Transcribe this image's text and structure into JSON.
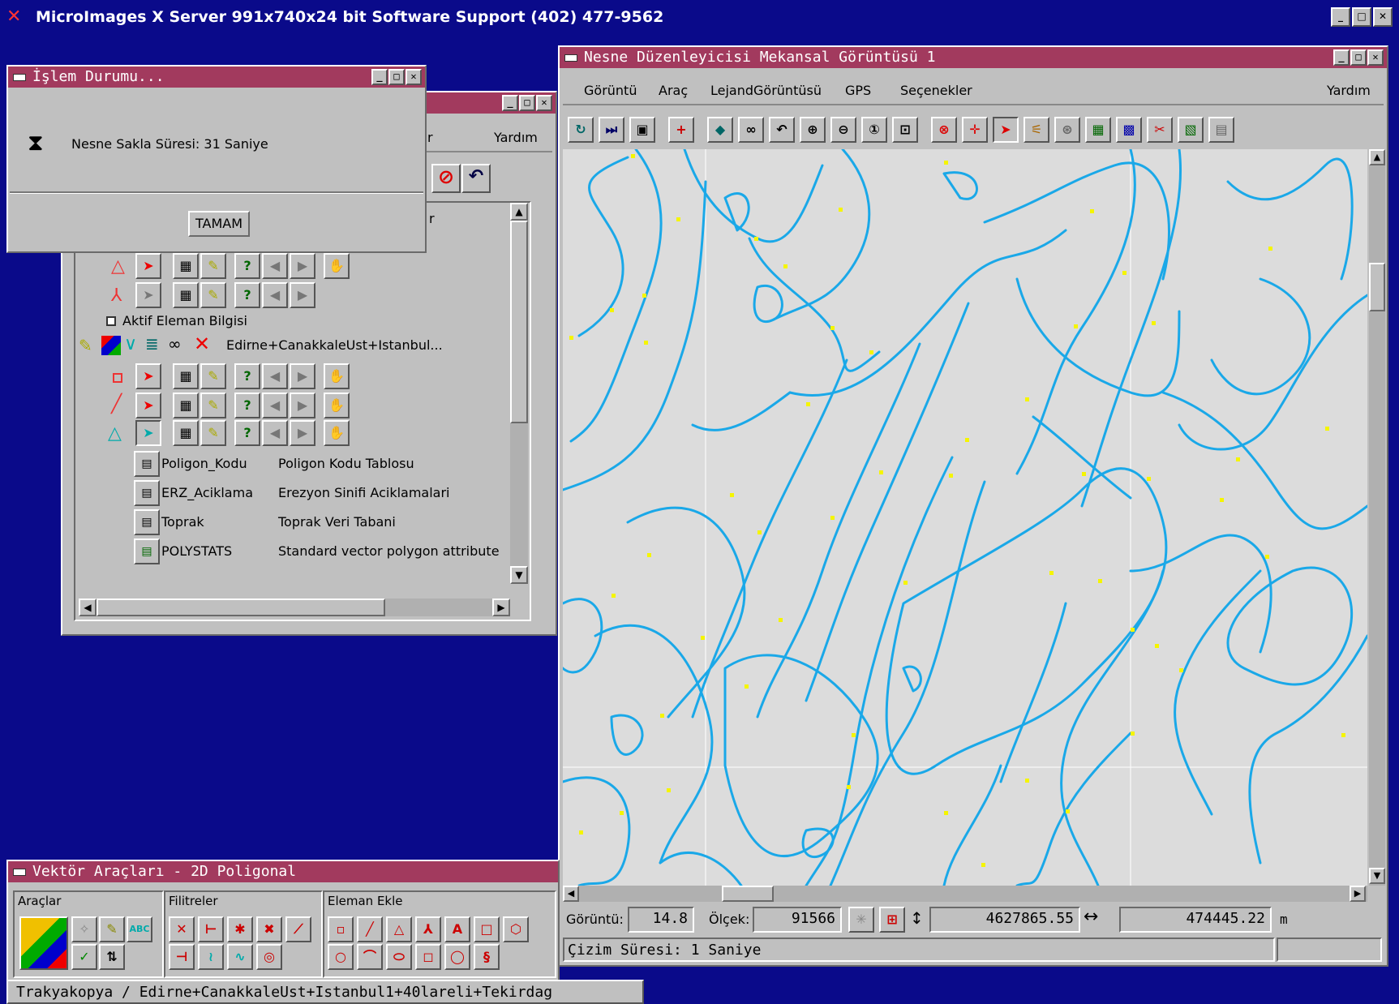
{
  "screen": {
    "title": "MicroImages X Server  991x740x24 bit  Software Support (402) 477-9562"
  },
  "status_dialog": {
    "title": "İşlem Durumu...",
    "message": "Nesne Sakla Süresi: 31 Saniye",
    "ok_label": "TAMAM"
  },
  "layer_manager": {
    "help_menu": "Yardım",
    "partial_menu": "r",
    "partial_text": "r",
    "active_info_label": "Aktif Eleman Bilgisi",
    "layer_name": "Edirne+CanakkaleUst+Istanbul...",
    "tables": [
      {
        "name": "Poligon_Kodu",
        "desc": "Poligon Kodu Tablosu"
      },
      {
        "name": "ERZ_Aciklama",
        "desc": "Erezyon Sinifi Aciklamalari"
      },
      {
        "name": "Toprak",
        "desc": "Toprak Veri Tabani"
      },
      {
        "name": "POLYSTATS",
        "desc": "Standard vector polygon attribute"
      }
    ]
  },
  "view_window": {
    "title": "Nesne Düzenleyicisi Mekansal Görüntüsü 1",
    "menu": [
      "Görüntü",
      "Araç",
      "LejandGörüntüsü",
      "GPS",
      "Seçenekler"
    ],
    "help": "Yardım",
    "status": {
      "view_label": "Görüntü:",
      "view_value": "14.8",
      "scale_label": "Ölçek:",
      "scale_value": "91566",
      "northing": "4627865.55",
      "easting": "474445.22",
      "unit": "m",
      "draw_time": "Çizim Süresi: 1 Saniye"
    },
    "colors": {
      "map_bg": "#dcdcdc",
      "line": "#1aa8e8",
      "node": "#f5f500"
    }
  },
  "vector_tools": {
    "title": "Vektör Araçları - 2D Poligonal",
    "groups": [
      "Araçlar",
      "Filitreler",
      "Eleman Ekle"
    ]
  },
  "footer_path": "Trakyakopya / Edirne+CanakkaleUst+Istanbul1+40lareli+Tekirdag"
}
